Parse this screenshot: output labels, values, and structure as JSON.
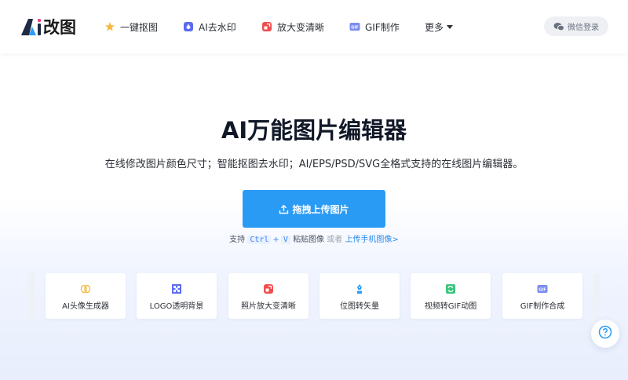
{
  "brand": {
    "logo_text": "改图",
    "logo_letters": "Ai"
  },
  "nav": {
    "items": [
      {
        "label": "一键抠图",
        "icon": "star-cutout-icon"
      },
      {
        "label": "AI去水印",
        "icon": "watermark-icon"
      },
      {
        "label": "放大变清晰",
        "icon": "enlarge-icon"
      },
      {
        "label": "GIF制作",
        "icon": "gif-icon"
      },
      {
        "label": "更多",
        "icon": "chevron-down-icon"
      }
    ],
    "login_label": "微信登录"
  },
  "hero": {
    "title": "AI万能图片编辑器",
    "subtitle": "在线修改图片颜色尺寸；智能抠图去水印；AI/EPS/PSD/SVG全格式支持的在线图片编辑器。",
    "upload_label": "拖拽上传图片",
    "hint": {
      "prefix": "支持",
      "key1": "Ctrl",
      "plus": "+",
      "key2": "V",
      "middle": "粘贴图像",
      "or": "或者",
      "mobile_link": "上传手机图像>"
    }
  },
  "tools": [
    {
      "label": "AI头像生成器",
      "icon": "avatar-generator-icon"
    },
    {
      "label": "LOGO透明背景",
      "icon": "transparent-bg-icon"
    },
    {
      "label": "照片放大变清晰",
      "icon": "photo-enlarge-icon"
    },
    {
      "label": "位图转矢量",
      "icon": "vector-icon"
    },
    {
      "label": "视频转GIF动图",
      "icon": "video-gif-icon"
    },
    {
      "label": "GIF制作合成",
      "icon": "gif-make-icon"
    }
  ],
  "colors": {
    "primary": "#2a9bf5",
    "link": "#2a8af0",
    "text": "#1f2329"
  }
}
